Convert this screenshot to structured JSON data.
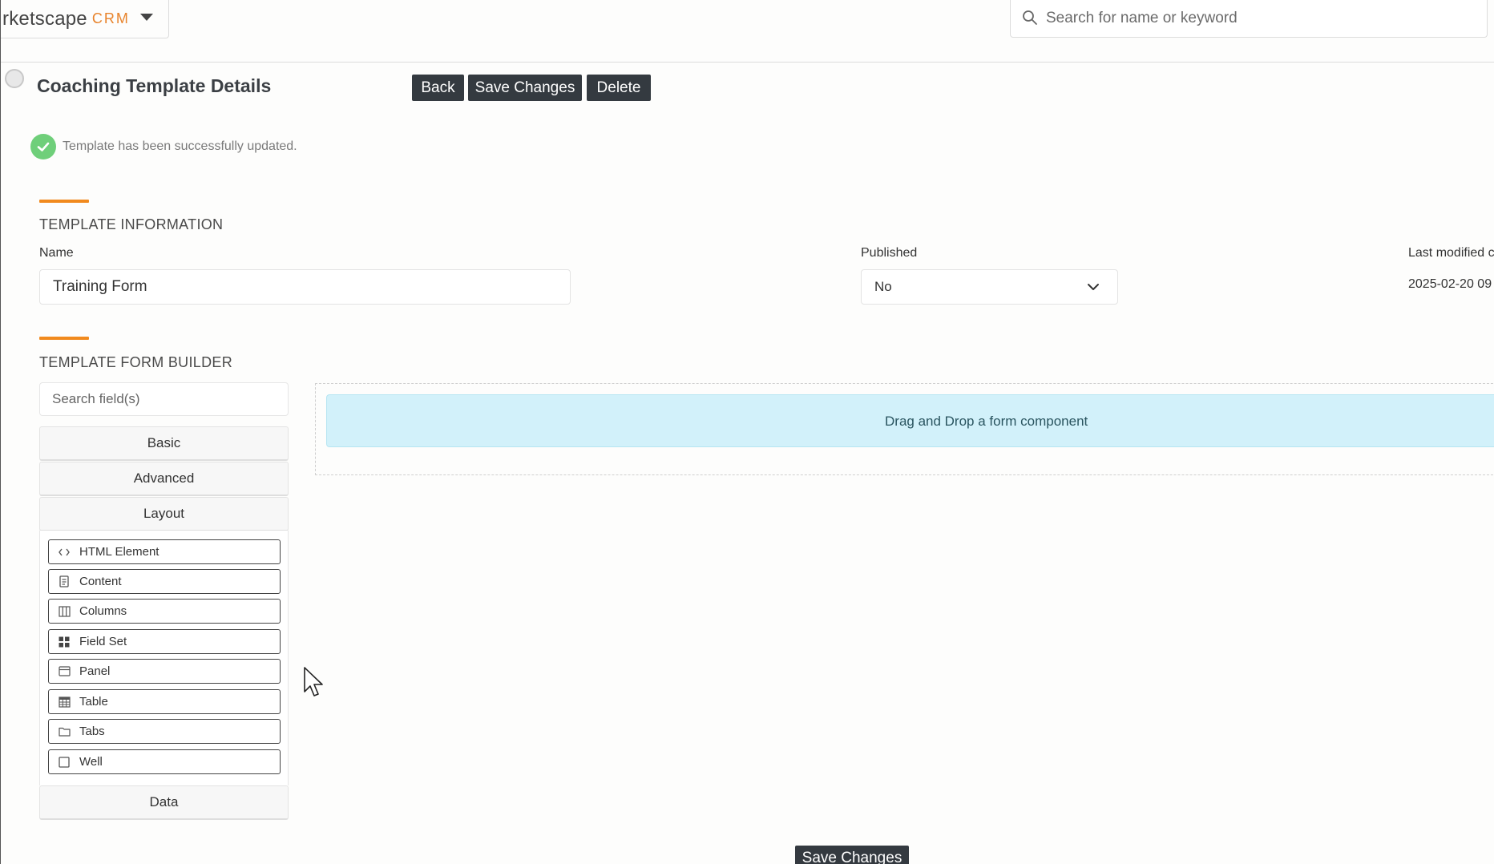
{
  "topbar": {
    "brand_name": "rketscape",
    "brand_suffix": "CRM",
    "search_placeholder": "Search for name or keyword"
  },
  "header": {
    "title": "Coaching Template Details",
    "back_label": "Back",
    "save_label": "Save Changes",
    "delete_label": "Delete"
  },
  "alert": {
    "message": "Template has been successfully updated."
  },
  "template_info": {
    "section_title": "TEMPLATE INFORMATION",
    "name_label": "Name",
    "name_value": "Training Form",
    "published_label": "Published",
    "published_value": "No",
    "last_modified_label": "Last modified c",
    "last_modified_value": "2025-02-20 09"
  },
  "form_builder": {
    "section_title": "TEMPLATE FORM BUILDER",
    "search_placeholder": "Search field(s)",
    "groups": {
      "basic": "Basic",
      "advanced": "Advanced",
      "layout": "Layout",
      "data": "Data"
    },
    "layout_components": [
      {
        "label": "HTML Element",
        "icon": "code-icon"
      },
      {
        "label": "Content",
        "icon": "file-text-icon"
      },
      {
        "label": "Columns",
        "icon": "columns-icon"
      },
      {
        "label": "Field Set",
        "icon": "grid-icon"
      },
      {
        "label": "Panel",
        "icon": "panel-icon"
      },
      {
        "label": "Table",
        "icon": "table-icon"
      },
      {
        "label": "Tabs",
        "icon": "folder-icon"
      },
      {
        "label": "Well",
        "icon": "square-icon"
      }
    ],
    "drop_text": "Drag and Drop a form component"
  },
  "footer": {
    "save_label": "Save Changes"
  },
  "colors": {
    "accent": "#f18a1e",
    "button_dark": "#343a40",
    "success": "#6fcf7a",
    "drop_bg": "#d2f1fa"
  }
}
